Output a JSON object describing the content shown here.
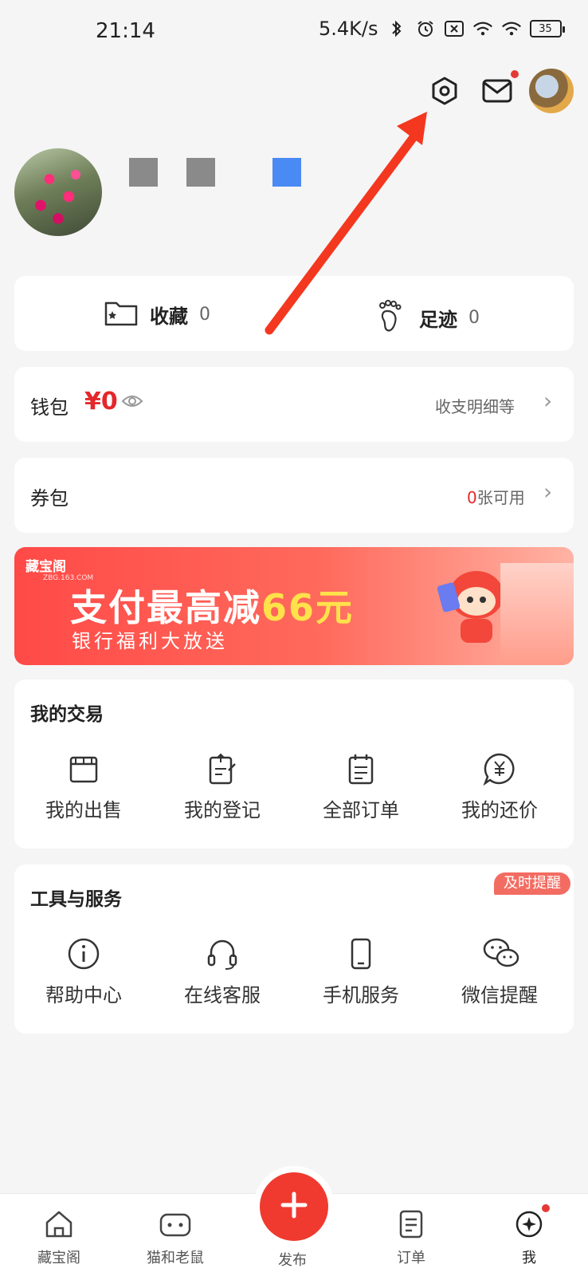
{
  "status_bar": {
    "time": "21:14",
    "net_speed": "5.4K/s",
    "battery": "35",
    "icons": [
      "bluetooth-icon",
      "alarm-icon",
      "sim-off-icon",
      "wifi-icon",
      "wifi-icon"
    ]
  },
  "header": {
    "icons": [
      "gear-icon",
      "mail-icon",
      "avatar"
    ]
  },
  "collect_card": {
    "favorites_label": "收藏",
    "favorites_count": "0",
    "footprint_label": "足迹",
    "footprint_count": "0"
  },
  "wallet": {
    "label": "钱包",
    "amount": "¥0",
    "detail": "收支明细等"
  },
  "coupon": {
    "label": "券包",
    "count": "0",
    "suffix": "张可用"
  },
  "banner": {
    "logo": "藏宝阁",
    "logo_sub": "ZBG.163.COM",
    "title_prefix": "支付最高减",
    "title_highlight": "66元",
    "subtitle": "银行福利大放送"
  },
  "trade": {
    "title": "我的交易",
    "items": [
      {
        "label": "我的出售",
        "icon": "store-icon"
      },
      {
        "label": "我的登记",
        "icon": "register-icon"
      },
      {
        "label": "全部订单",
        "icon": "calendar-list-icon"
      },
      {
        "label": "我的还价",
        "icon": "yuan-chat-icon"
      }
    ]
  },
  "tools": {
    "title": "工具与服务",
    "badge": "及时提醒",
    "items": [
      {
        "label": "帮助中心",
        "icon": "info-icon"
      },
      {
        "label": "在线客服",
        "icon": "headset-icon"
      },
      {
        "label": "手机服务",
        "icon": "phone-icon"
      },
      {
        "label": "微信提醒",
        "icon": "wechat-icon"
      }
    ]
  },
  "bottom_nav": {
    "items": [
      {
        "label": "藏宝阁",
        "icon": "home-icon"
      },
      {
        "label": "猫和老鼠",
        "icon": "game-icon"
      },
      {
        "label": "发布",
        "icon": "plus-icon"
      },
      {
        "label": "订单",
        "icon": "order-icon"
      },
      {
        "label": "我",
        "icon": "profile-icon"
      }
    ]
  },
  "colors": {
    "accent": "#f03a2f",
    "price": "#e4282a",
    "badge": "#f36c62",
    "annotation_arrow": "#f4371f"
  }
}
